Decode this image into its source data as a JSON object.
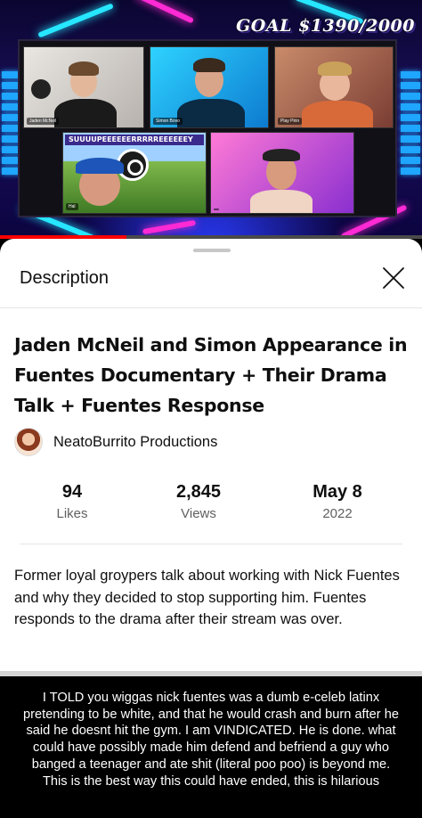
{
  "video": {
    "goal_overlay": "GOAL $1390/2000",
    "banner_text": "SUUUUPEEEEEERRRRREEEEEEY",
    "tiles": [
      {
        "name": "Jaden McNeil"
      },
      {
        "name": "Simon Bovo"
      },
      {
        "name": "Play Pirin"
      },
      {
        "name": "Hal"
      },
      {
        "name": ""
      }
    ],
    "progress_percent": 30,
    "colors": {
      "accent_red": "#ff0000",
      "neon_cyan": "#27e6ff",
      "neon_pink": "#ff2ad4"
    }
  },
  "panel": {
    "title": "Description",
    "close_icon": "close-icon",
    "video_title": "Jaden McNeil and Simon Appearance in Fuentes Documentary + Their Drama Talk + Fuentes Response",
    "channel_name": "NeatoBurrito Productions",
    "stats": [
      {
        "value": "94",
        "label": "Likes"
      },
      {
        "value": "2,845",
        "label": "Views"
      },
      {
        "value": "May 8",
        "label": "2022"
      }
    ],
    "description": "Former loyal groypers talk about working with Nick Fuentes and why they decided to stop supporting him. Fuentes responds to the drama after their stream was over."
  },
  "caption": {
    "text": "I TOLD you wiggas nick fuentes was a dumb e-celeb latinx pretending to be white, and that he would crash and burn after he said he doesnt hit the gym. I am VINDICATED. He is done. what could have possibly made him defend and befriend a guy who banged a teenager and ate shit (literal poo poo) is beyond me. This is the best way this could have ended, this is hilarious"
  }
}
